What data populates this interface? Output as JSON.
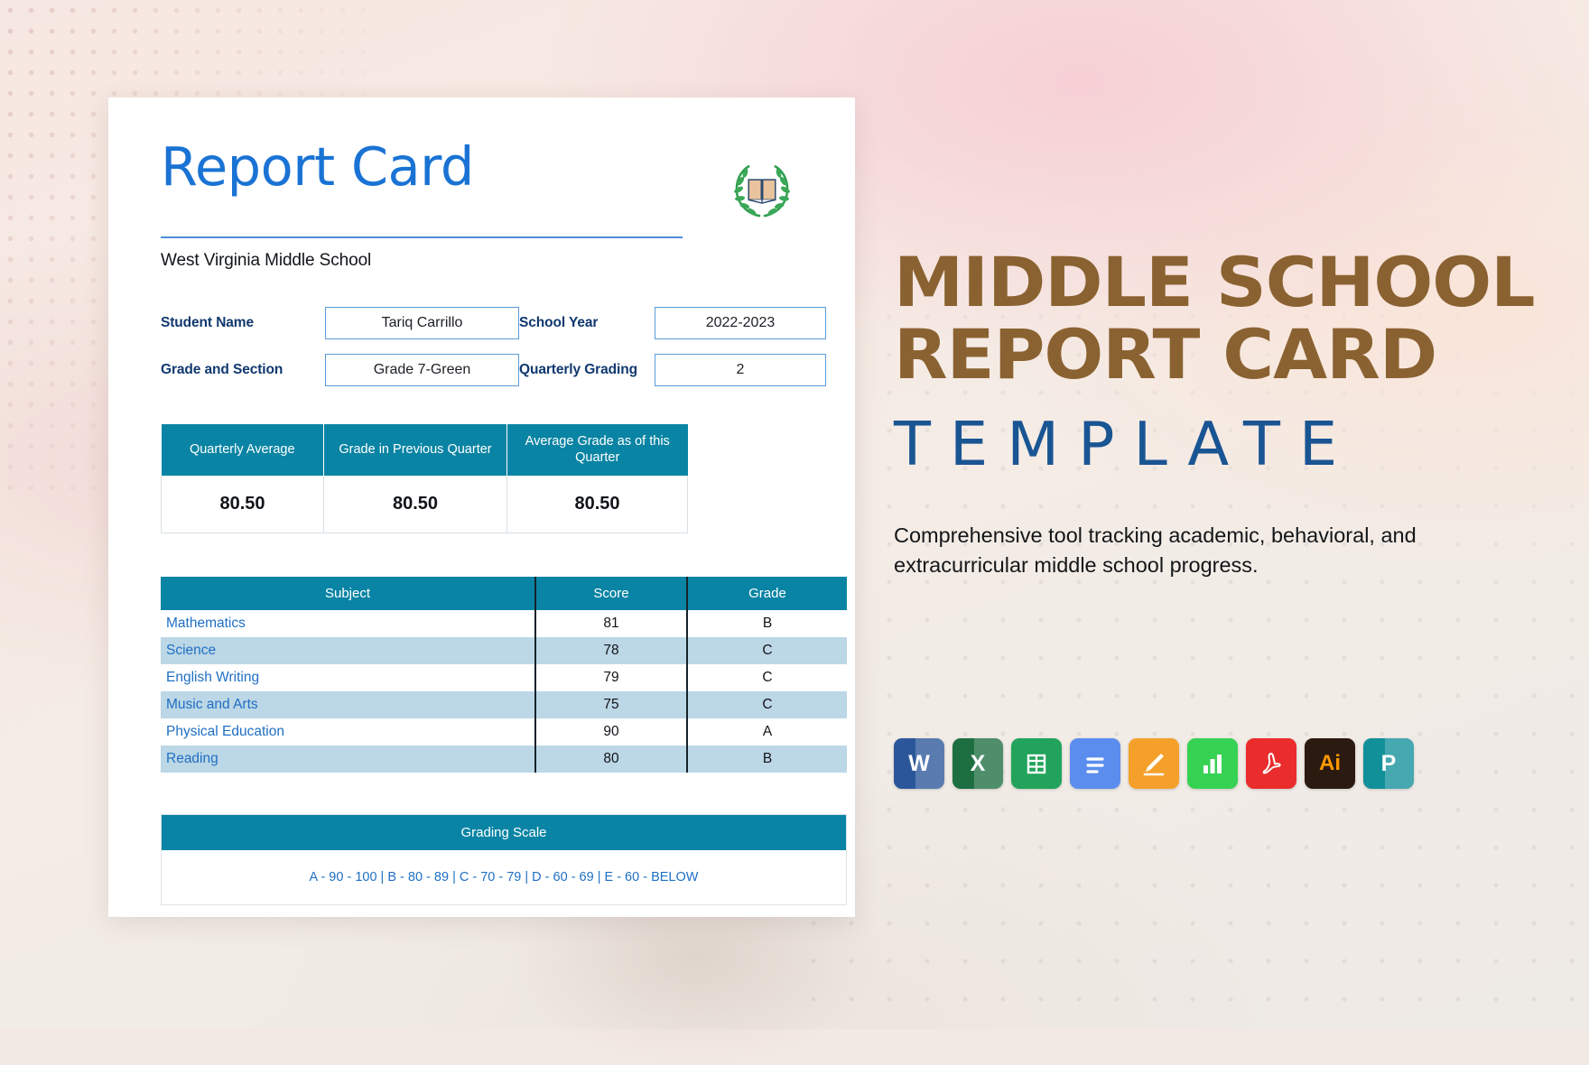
{
  "document": {
    "title": "Report Card",
    "school_name": "West Virginia Middle School",
    "emblem_icon": "laurel-wreath-book-icon",
    "fields": {
      "student_name_label": "Student Name",
      "student_name_value": "Tariq Carrillo",
      "school_year_label": "School Year",
      "school_year_value": "2022-2023",
      "grade_section_label": "Grade and Section",
      "grade_section_value": "Grade 7-Green",
      "quarterly_grading_label": "Quarterly Grading",
      "quarterly_grading_value": "2"
    },
    "averages_table": {
      "headers": [
        "Quarterly Average",
        "Grade in Previous Quarter",
        "Average Grade as of this Quarter"
      ],
      "values": [
        "80.50",
        "80.50",
        "80.50"
      ]
    },
    "subjects_table": {
      "headers": [
        "Subject",
        "Score",
        "Grade"
      ],
      "rows": [
        {
          "subject": "Mathematics",
          "score": "81",
          "grade": "B"
        },
        {
          "subject": "Science",
          "score": "78",
          "grade": "C"
        },
        {
          "subject": "English Writing",
          "score": "79",
          "grade": "C"
        },
        {
          "subject": "Music and Arts",
          "score": "75",
          "grade": "C"
        },
        {
          "subject": "Physical Education",
          "score": "90",
          "grade": "A"
        },
        {
          "subject": "Reading",
          "score": "80",
          "grade": "B"
        }
      ]
    },
    "grading_scale": {
      "header": "Grading Scale",
      "text": "A - 90 - 100 | B - 80 - 89 | C - 70 - 79 | D - 60 - 69 | E - 60 - BELOW"
    }
  },
  "promo": {
    "line1": "MIDDLE SCHOOL",
    "line2": "REPORT CARD",
    "line3": "TEMPLATE",
    "description": "Comprehensive tool tracking academic, behavioral, and extracurricular middle school progress."
  },
  "app_icons": [
    {
      "name": "microsoft-word-icon",
      "glyph": "W"
    },
    {
      "name": "microsoft-excel-icon",
      "glyph": "X"
    },
    {
      "name": "google-sheets-icon",
      "glyph": ""
    },
    {
      "name": "google-docs-icon",
      "glyph": ""
    },
    {
      "name": "apple-pages-icon",
      "glyph": ""
    },
    {
      "name": "apple-numbers-icon",
      "glyph": ""
    },
    {
      "name": "adobe-pdf-icon",
      "glyph": ""
    },
    {
      "name": "adobe-illustrator-icon",
      "glyph": "Ai"
    },
    {
      "name": "microsoft-publisher-icon",
      "glyph": "P"
    }
  ],
  "colors": {
    "title_blue": "#1a73d4",
    "header_teal": "#0a84a4",
    "row_alt": "#bcd7e6",
    "promo_brown": "#8a6231",
    "promo_blue": "#1a5593",
    "label_navy": "#10386e"
  }
}
